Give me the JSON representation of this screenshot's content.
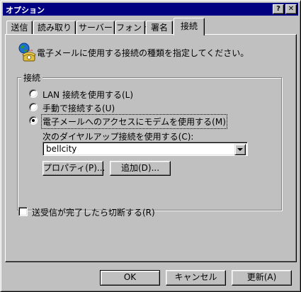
{
  "window": {
    "title": "オプション",
    "help_button": "?",
    "close_button": "✕"
  },
  "tabs": [
    {
      "label": "送信"
    },
    {
      "label": "読み取り"
    },
    {
      "label": "サーバー"
    },
    {
      "label": "フォント"
    },
    {
      "label": "署名"
    },
    {
      "label": "接続",
      "active": true
    }
  ],
  "panel": {
    "icon": "phone-globe-icon",
    "description": "電子メールに使用する接続の種類を指定してください。",
    "group_label": "接続",
    "options": [
      {
        "label": "LAN 接続を使用する(L)",
        "checked": false
      },
      {
        "label": "手動で接続する(U)",
        "checked": false
      },
      {
        "label": "電子メールへのアクセスにモデムを使用する(M)",
        "checked": true
      }
    ],
    "dialup_label": "次のダイヤルアップ接続を使用する(C):",
    "dialup_value": "bellcity",
    "properties_button": "プロパティ(P)...",
    "add_button": "追加(D)...",
    "disconnect_label": "送受信が完了したら切断する(R)",
    "disconnect_checked": false
  },
  "footer": {
    "ok_button": "OK",
    "cancel_button": "キャンセル",
    "apply_button": "更新(A)"
  },
  "colors": {
    "titlebar": "#000080",
    "face": "#c0c0c0"
  }
}
